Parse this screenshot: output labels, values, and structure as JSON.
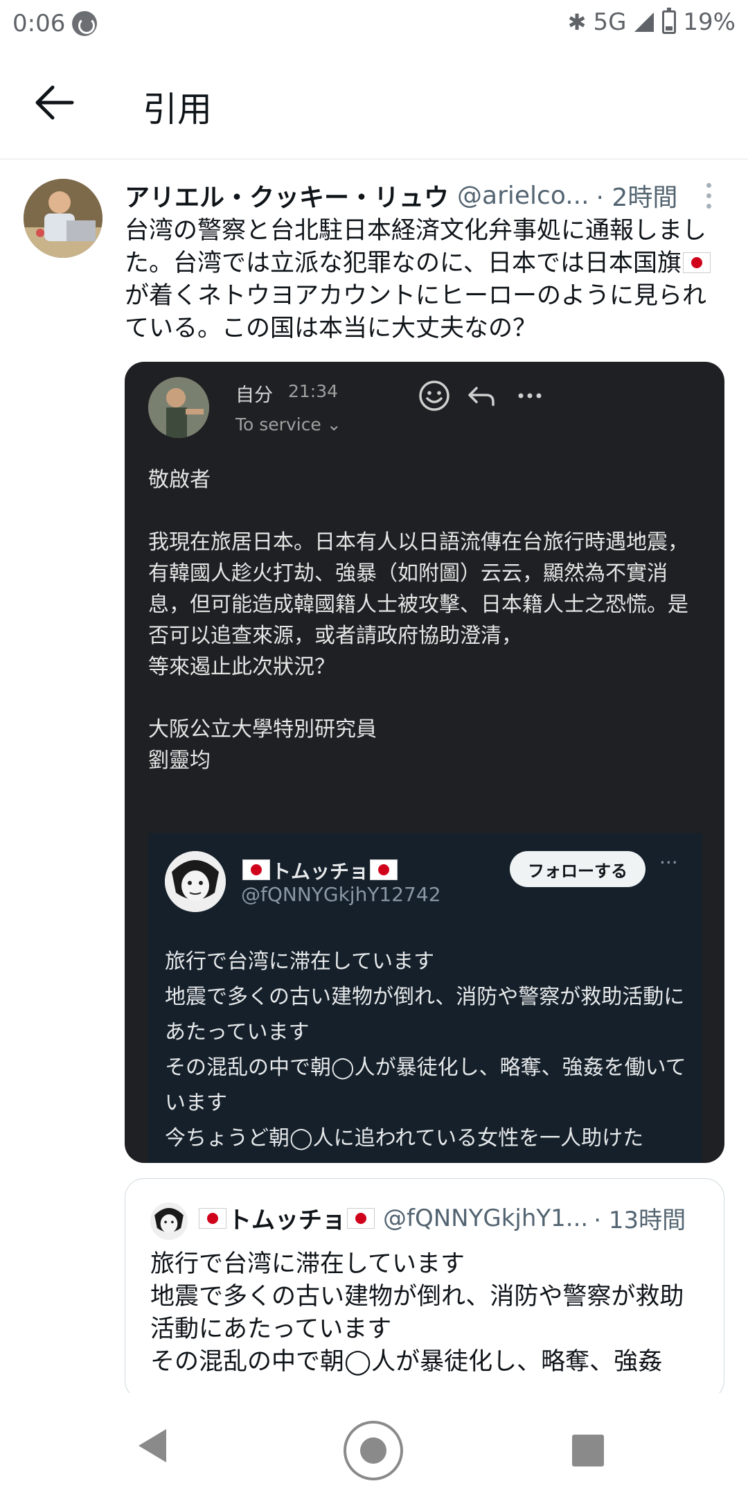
{
  "status_bar": {
    "time": "0:06",
    "network": "5G",
    "battery": "19%"
  },
  "header": {
    "title": "引用"
  },
  "tweet": {
    "name": "アリエル・クッキー・リュウ",
    "handle": "@arielco...",
    "time": "· 2時間",
    "text_before_flag": "台湾の警察と台北駐日本経済文化弁事処に通報しました。台湾では立派な犯罪なのに、日本では日本国旗",
    "text_after_flag": "が着くネトウヨアカウントにヒーローのように見られている。この国は本当に大丈夫なの？"
  },
  "media": {
    "sender": "自分",
    "time": "21:34",
    "to": "To service ⌄",
    "body": "敬啟者\n\n我現在旅居日本。日本有人以日語流傳在台旅行時遇地震，有韓國人趁火打劫、強暴（如附圖）云云，顯然為不實消息，但可能造成韓國籍人士被攻擊、日本籍人士之恐慌。是否可以追查來源，或者請政府協助澄清，\n等來遏止此次狀況？\n\n大阪公立大學特別研究員\n劉靈均",
    "embed": {
      "name": "トムッチョ",
      "handle": "@fQNNYGkjhY12742",
      "follow_label": "フォローする",
      "more": "···",
      "text": "旅行で台湾に滞在しています\n地震で多くの古い建物が倒れ、消防や警察が救助活動にあたっています\nその混乱の中で朝◯人が暴徒化し、略奪、強姦を働いています\n今ちょうど朝◯人に追われている女性を一人助けた"
    }
  },
  "quote": {
    "name": "トムッチョ",
    "handle": "@fQNNYGkjhY1...",
    "time": "· 13時間",
    "text": "旅行で台湾に滞在しています\n地震で多くの古い建物が倒れ、消防や警察が救助活動にあたっています\nその混乱の中で朝◯人が暴徒化し、略奪、強姦"
  }
}
